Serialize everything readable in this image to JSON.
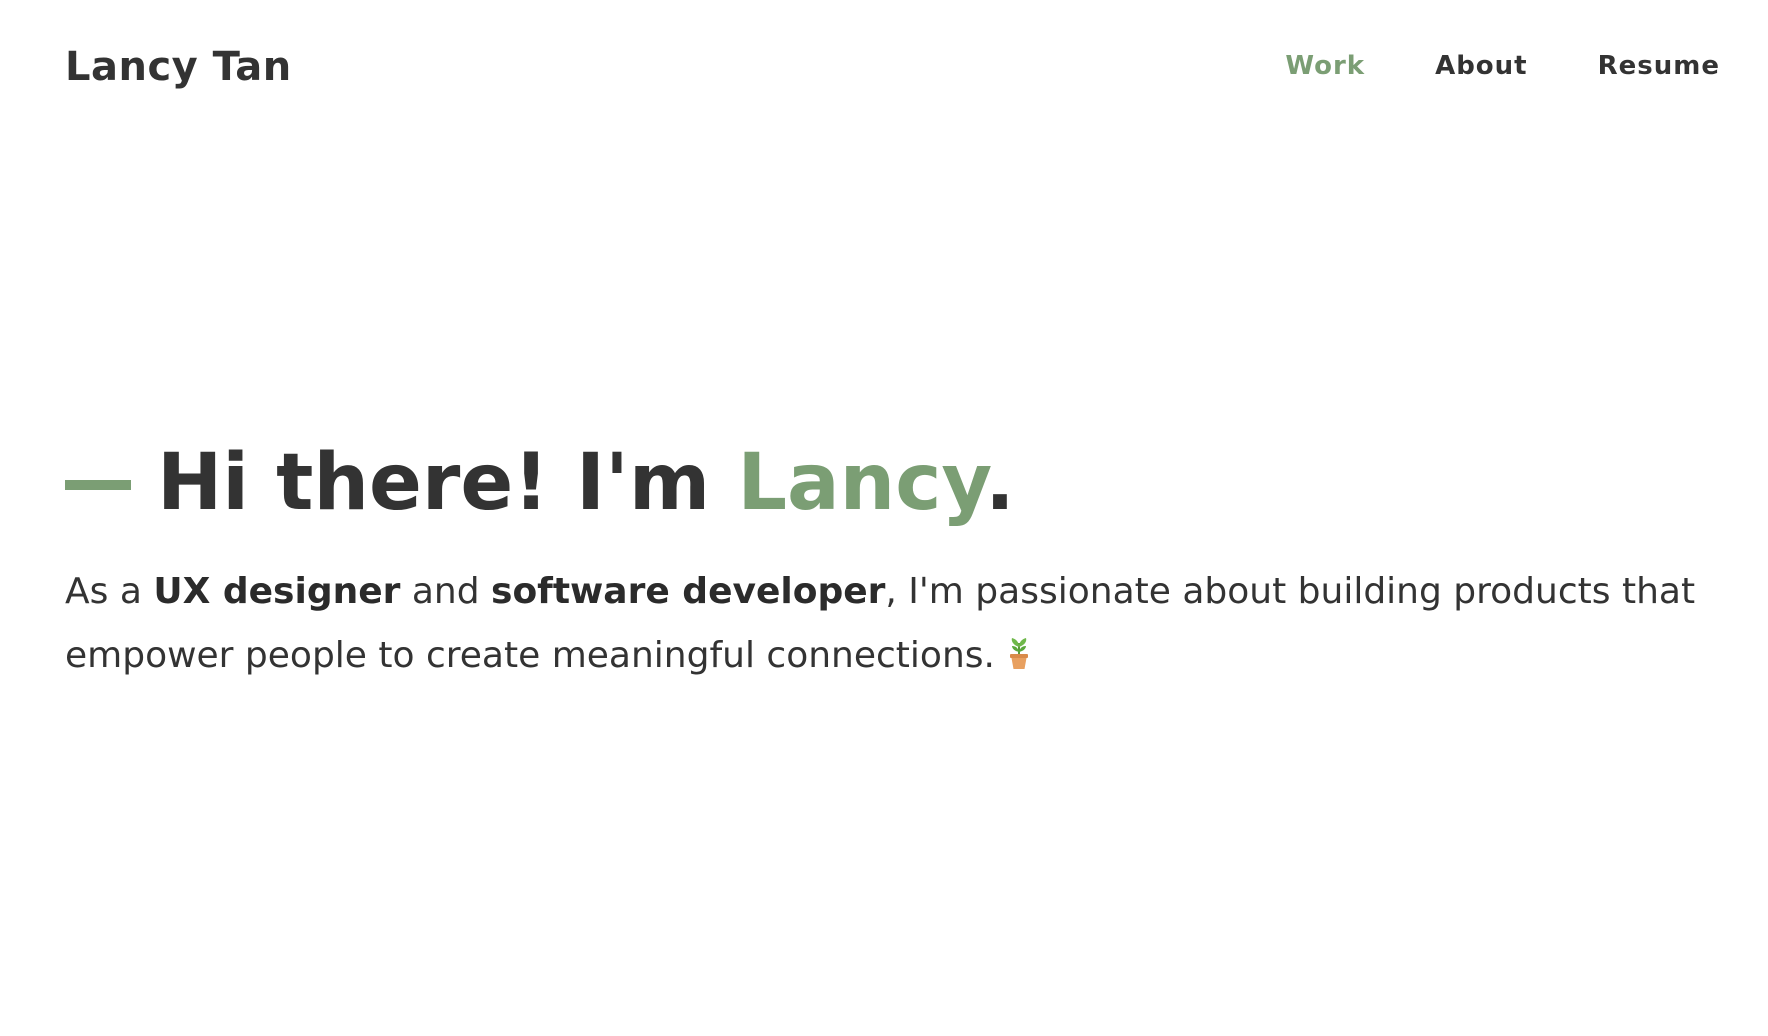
{
  "header": {
    "logo": "Lancy Tan",
    "nav": [
      {
        "label": "Work",
        "active": true
      },
      {
        "label": "About",
        "active": false
      },
      {
        "label": "Resume",
        "active": false
      }
    ]
  },
  "hero": {
    "greeting_prefix": "Hi there! I'm ",
    "greeting_name": "Lancy",
    "greeting_suffix": ".",
    "intro": {
      "part1": "As a ",
      "bold1": "UX designer",
      "part2": " and ",
      "bold2": "software developer",
      "part3": ", I'm passionate about building products that empower people to create meaningful connections."
    },
    "emoji_icon": "potted-plant-icon"
  },
  "colors": {
    "accent": "#7b9e74",
    "text": "#333333",
    "background": "#ffffff"
  }
}
